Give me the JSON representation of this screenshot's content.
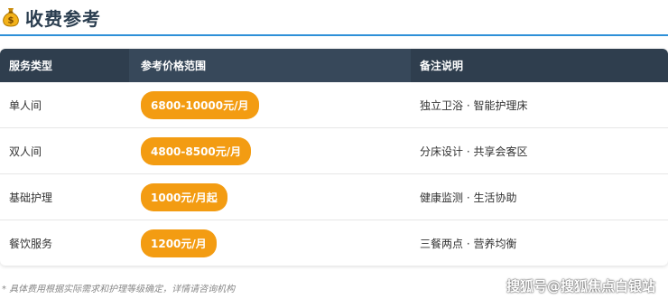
{
  "header": {
    "title": "收费参考",
    "icon": "money-bag-icon"
  },
  "table": {
    "headers": [
      "服务类型",
      "参考价格范围",
      "备注说明"
    ],
    "rows": [
      {
        "type": "单人间",
        "price": "6800-10000元/月",
        "note": "独立卫浴 · 智能护理床"
      },
      {
        "type": "双人间",
        "price": "4800-8500元/月",
        "note": "分床设计 · 共享会客区"
      },
      {
        "type": "基础护理",
        "price": "1000元/月起",
        "note": "健康监测 · 生活协助"
      },
      {
        "type": "餐饮服务",
        "price": "1200元/月",
        "note": "三餐两点 · 营养均衡"
      }
    ]
  },
  "footnote": "* 具体费用根据实际需求和护理等级确定，详情请咨询机构",
  "watermark": "搜狐号@搜狐焦点白银站",
  "colors": {
    "accent_line": "#2e90d8",
    "header_bg": "#2f3e4e",
    "pill": "#f39c12"
  }
}
